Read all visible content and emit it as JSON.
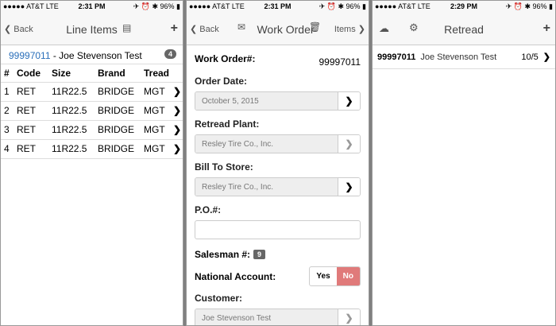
{
  "status": [
    {
      "carrier": "●●●●● AT&T  LTE",
      "time": "2:31 PM",
      "battery": "✈ ⏰ ✱ 96% ▮"
    },
    {
      "carrier": "●●●●● AT&T  LTE",
      "time": "2:31 PM",
      "battery": "✈ ⏰ ✱ 96% ▮"
    },
    {
      "carrier": "●●●●● AT&T  LTE",
      "time": "2:29 PM",
      "battery": "✈ ⏰ ✱ 96% ▮"
    }
  ],
  "screen1": {
    "back": "❮ Back",
    "title": "Line Items",
    "add": "+",
    "customer_id": "99997011",
    "customer_sep": " - ",
    "customer_name": "Joe Stevenson Test",
    "badge": "4",
    "columns": [
      "#",
      "Code",
      "Size",
      "Brand",
      "Tread"
    ],
    "rows": [
      [
        "1",
        "RET",
        "11R22.5",
        "BRIDGE",
        "MGT"
      ],
      [
        "2",
        "RET",
        "11R22.5",
        "BRIDGE",
        "MGT"
      ],
      [
        "3",
        "RET",
        "11R22.5",
        "BRIDGE",
        "MGT"
      ],
      [
        "4",
        "RET",
        "11R22.5",
        "BRIDGE",
        "MGT"
      ]
    ]
  },
  "screen2": {
    "back": "❮ Back",
    "title": "Work Order",
    "items": "Items ❯",
    "work_order_label": "Work Order#:",
    "work_order_value": "99997011",
    "order_date_label": "Order Date:",
    "order_date_value": "October 5, 2015",
    "retread_plant_label": "Retread Plant:",
    "retread_plant_value": "Resley Tire Co., Inc.",
    "bill_to_label": "Bill To Store:",
    "bill_to_value": "Resley Tire Co., Inc.",
    "po_label": "P.O.#:",
    "salesman_label": "Salesman #:",
    "salesman_value": "9",
    "national_label": "National Account:",
    "yes": "Yes",
    "no": "No",
    "customer_label": "Customer:",
    "customer_value": "Joe Stevenson Test"
  },
  "screen3": {
    "title": "Retread",
    "add": "+",
    "row_id": "99997011",
    "row_name": "Joe Stevenson Test",
    "row_count": "10/5"
  }
}
